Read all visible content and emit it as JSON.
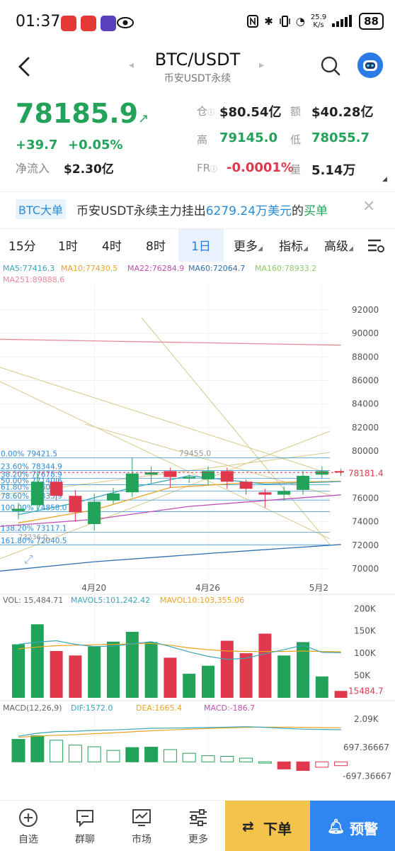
{
  "status_bar": {
    "time": "01:37",
    "net_speed_value": "25.9",
    "net_speed_unit": "K/s",
    "battery": "88"
  },
  "header": {
    "title": "BTC/USDT",
    "subtitle": "币安USDT永续"
  },
  "price": {
    "last": "78185.9",
    "change": "+39.7",
    "change_pct": "+0.05%",
    "inflow_label": "净流入",
    "inflow_value": "$2.30亿"
  },
  "stats": [
    {
      "label": "仓",
      "value": "$80.54亿",
      "color": "#222222"
    },
    {
      "label": "额",
      "value": "$40.28亿",
      "color": "#222222"
    },
    {
      "label": "高",
      "value": "79145.0",
      "color": "#23a35a"
    },
    {
      "label": "低",
      "value": "78055.7",
      "color": "#23a35a"
    },
    {
      "label": "FR",
      "value": "-0.0001%",
      "color": "#e0394d"
    },
    {
      "label": "量",
      "value": "5.14万",
      "color": "#222222"
    }
  ],
  "notice": {
    "tag": "BTC大单",
    "text_pre": "币安USDT永续主力挂出",
    "amount": "6279.24万美元",
    "text_mid": "的",
    "side": "买单"
  },
  "tabs": [
    "15分",
    "1时",
    "4时",
    "8时",
    "1日",
    "更多",
    "指标",
    "高级"
  ],
  "active_tab": "1日",
  "ma_legend": [
    {
      "text": "MA5:77416.3",
      "color": "#3aa6b9"
    },
    {
      "text": "MA10:77430.5",
      "color": "#e9a426"
    },
    {
      "text": "MA22:76284.9",
      "color": "#c04fb5"
    },
    {
      "text": "MA60:72064.7",
      "color": "#2f6fb3"
    },
    {
      "text": "MA160:78933.2",
      "color": "#8fc96a"
    },
    {
      "text": "MA251:89888.6",
      "color": "#e98a99"
    }
  ],
  "vol_legend": [
    {
      "text": "VOL: 15,484.71",
      "color": "#666666"
    },
    {
      "text": "MAVOL5:101,242.42",
      "color": "#3aa6b9"
    },
    {
      "text": "MAVOL10:103,355.06",
      "color": "#e9a426"
    }
  ],
  "macd_legend": [
    {
      "text": "MACD(12,26,9)",
      "color": "#666666"
    },
    {
      "text": "DIF:1572.0",
      "color": "#3aa6b9"
    },
    {
      "text": "DEA:1665.4",
      "color": "#e9a426"
    },
    {
      "text": "MACD:-186.7",
      "color": "#c04fb5"
    }
  ],
  "colors": {
    "up": "#23a35a",
    "down": "#e0394d",
    "accent": "#2a7be4",
    "fib": "#2a8bd8"
  },
  "chart_data": {
    "type": "candlestick",
    "price_axis_ticks": [
      92000,
      90000,
      88000,
      86000,
      84000,
      82000,
      80000,
      78000,
      76000,
      74000,
      72000,
      70000
    ],
    "price_ylim": [
      68800,
      93500
    ],
    "current_price_label": "78181.4",
    "high_marker": "79455.0",
    "low_marker": "73236.0",
    "x_tick_labels": [
      {
        "label": "4月20",
        "index": 4
      },
      {
        "label": "4月26",
        "index": 10
      },
      {
        "label": "5月2",
        "index": 16
      }
    ],
    "candles": [
      {
        "o": 74900,
        "c": 75100,
        "h": 75600,
        "l": 74200
      },
      {
        "o": 75400,
        "c": 77400,
        "h": 78200,
        "l": 75000
      },
      {
        "o": 77400,
        "c": 76200,
        "h": 77700,
        "l": 75800
      },
      {
        "o": 76200,
        "c": 74800,
        "h": 76700,
        "l": 74000
      },
      {
        "o": 73800,
        "c": 75700,
        "h": 76400,
        "l": 73236
      },
      {
        "o": 75800,
        "c": 76400,
        "h": 76900,
        "l": 75500
      },
      {
        "o": 76500,
        "c": 78100,
        "h": 79455,
        "l": 76100
      },
      {
        "o": 78000,
        "c": 78200,
        "h": 78700,
        "l": 77300
      },
      {
        "o": 78300,
        "c": 77800,
        "h": 78600,
        "l": 76900
      },
      {
        "o": 77700,
        "c": 77800,
        "h": 78000,
        "l": 77300
      },
      {
        "o": 77600,
        "c": 78300,
        "h": 78700,
        "l": 77100
      },
      {
        "o": 78300,
        "c": 77400,
        "h": 78600,
        "l": 76800
      },
      {
        "o": 77400,
        "c": 76800,
        "h": 77600,
        "l": 76300
      },
      {
        "o": 76500,
        "c": 76300,
        "h": 76800,
        "l": 75200
      },
      {
        "o": 76300,
        "c": 76600,
        "h": 77000,
        "l": 75800
      },
      {
        "o": 76700,
        "c": 77900,
        "h": 78300,
        "l": 76300
      },
      {
        "o": 78000,
        "c": 78300,
        "h": 78700,
        "l": 77700
      },
      {
        "o": 78300,
        "c": 78181.4,
        "h": 78500,
        "l": 77900
      }
    ],
    "fib_levels": [
      {
        "label": "0.00% 79421.5",
        "value": 79421.5
      },
      {
        "label": "23.60% 78344.9",
        "value": 78344.9
      },
      {
        "label": "38.20% 77678.9",
        "value": 77678.9
      },
      {
        "label": "50.00% 77140.6",
        "value": 77140.6
      },
      {
        "label": "61.80% 76602.3",
        "value": 76602.3
      },
      {
        "label": "78.60% 75835.9",
        "value": 75835.9
      },
      {
        "label": "100.00% 74858.0",
        "value": 74858.0
      },
      {
        "label": "138.20% 73117.1",
        "value": 73117.1
      },
      {
        "label": "161.80% 72040.5",
        "value": 72040.5
      }
    ],
    "ma_lines": [
      {
        "name": "MA251",
        "color": "#e98a99",
        "points": [
          [
            -1,
            89500
          ],
          [
            17,
            89000
          ]
        ]
      },
      {
        "name": "MA60",
        "color": "#2f6fb3",
        "points": [
          [
            -1,
            69800
          ],
          [
            4,
            70600
          ],
          [
            10,
            71300
          ],
          [
            17,
            72064
          ]
        ]
      },
      {
        "name": "MA22",
        "color": "#c04fb5",
        "points": [
          [
            -1,
            73600
          ],
          [
            4,
            74200
          ],
          [
            9,
            75300
          ],
          [
            13,
            75800
          ],
          [
            17,
            76284
          ]
        ]
      },
      {
        "name": "MA10",
        "color": "#e9a426",
        "points": [
          [
            0,
            73900
          ],
          [
            4,
            75000
          ],
          [
            8,
            76900
          ],
          [
            12,
            77300
          ],
          [
            17,
            77430
          ]
        ]
      },
      {
        "name": "MA5",
        "color": "#3aa6b9",
        "points": [
          [
            0,
            74600
          ],
          [
            3,
            75600
          ],
          [
            6,
            76900
          ],
          [
            9,
            77900
          ],
          [
            13,
            77200
          ],
          [
            17,
            77416
          ]
        ]
      }
    ],
    "volume_axis_ticks": [
      "200K",
      "150K",
      "100K",
      "50K"
    ],
    "volume_ymax": 210000,
    "current_volume_label": "15484.7",
    "volumes": [
      120000,
      165000,
      105000,
      95000,
      115000,
      126000,
      148000,
      125000,
      90000,
      54000,
      72000,
      128000,
      100000,
      144000,
      95000,
      125000,
      48000,
      15484.71
    ],
    "mavol5": [
      120000,
      125000,
      128000,
      120000,
      115000,
      116000,
      121000,
      126000,
      115000,
      103000,
      93000,
      86000,
      89000,
      99000,
      108000,
      118000,
      102000,
      101242
    ],
    "mavol10": [
      110000,
      114000,
      117000,
      118000,
      119000,
      120000,
      121000,
      122000,
      118000,
      112000,
      108000,
      105000,
      104000,
      104000,
      104000,
      105000,
      104000,
      103355
    ],
    "macd_axis_ticks": [
      "2.09K",
      "697.36667",
      "-697.36667"
    ],
    "macd_ylim": [
      -1100,
      2300
    ],
    "macd_hist": [
      1100,
      1280,
      1060,
      820,
      740,
      560,
      700,
      720,
      600,
      420,
      300,
      270,
      180,
      5,
      -350,
      -420,
      -260,
      -186.7
    ],
    "dif": [
      1250,
      1400,
      1480,
      1500,
      1540,
      1560,
      1600,
      1640,
      1650,
      1660,
      1680,
      1700,
      1720,
      1690,
      1640,
      1600,
      1585,
      1572
    ],
    "dea": [
      1200,
      1260,
      1300,
      1330,
      1380,
      1420,
      1470,
      1520,
      1560,
      1600,
      1630,
      1660,
      1690,
      1700,
      1700,
      1690,
      1675,
      1665.4
    ]
  },
  "bottom_nav": [
    {
      "label": "自选",
      "icon": "plus-circle-icon"
    },
    {
      "label": "群聊",
      "icon": "chat-icon"
    },
    {
      "label": "市场",
      "icon": "market-chart-icon"
    },
    {
      "label": "更多",
      "icon": "more-sliders-icon"
    }
  ],
  "order_button": "下单",
  "alert_button": "预警"
}
